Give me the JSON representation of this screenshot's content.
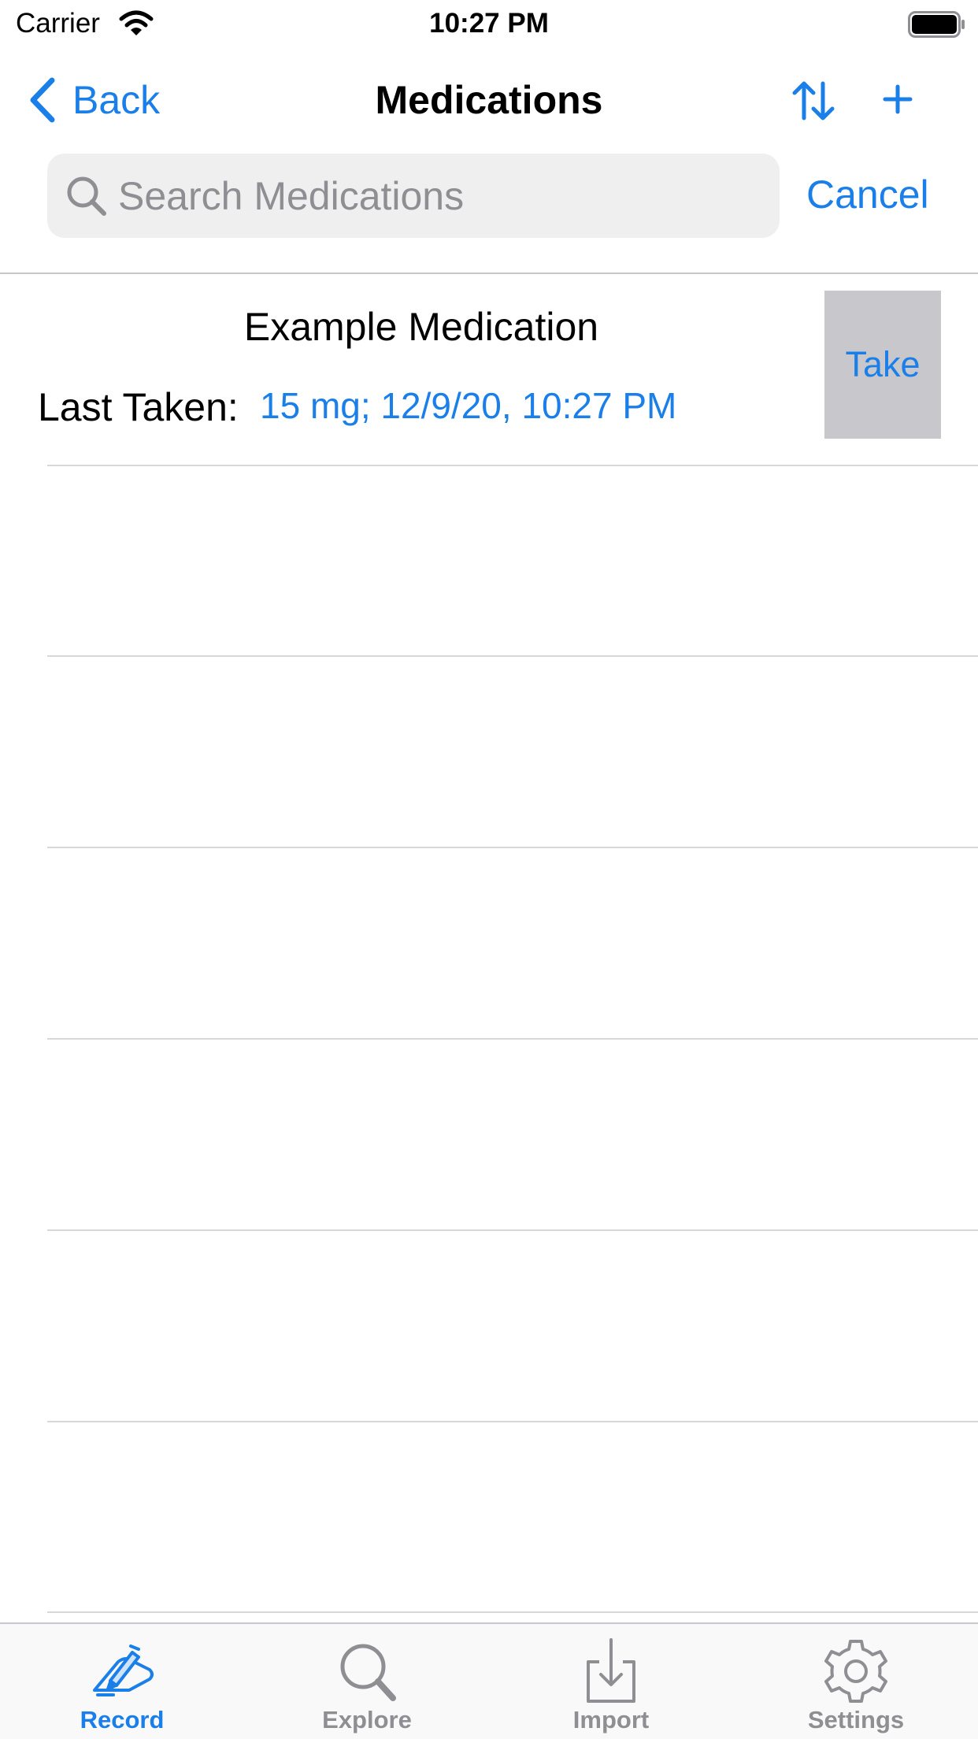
{
  "status_bar": {
    "carrier": "Carrier",
    "time": "10:27 PM"
  },
  "nav": {
    "back_label": "Back",
    "title": "Medications",
    "sort_icon": "sort-arrows-icon",
    "add_label": "+"
  },
  "search": {
    "placeholder": "Search Medications",
    "value": "",
    "cancel_label": "Cancel"
  },
  "medications": [
    {
      "name": "Example Medication",
      "last_taken_label": "Last Taken:",
      "last_taken_value": "15 mg; 12/9/20, 10:27 PM",
      "action_label": "Take"
    }
  ],
  "tabs": [
    {
      "label": "Record",
      "icon": "pencil-hand-icon",
      "active": true
    },
    {
      "label": "Explore",
      "icon": "magnifier-icon",
      "active": false
    },
    {
      "label": "Import",
      "icon": "import-tray-icon",
      "active": false
    },
    {
      "label": "Settings",
      "icon": "gear-icon",
      "active": false
    }
  ],
  "colors": {
    "accent": "#1a7fe8",
    "inactive": "#8e8e93",
    "take_button_bg": "#c7c7cc",
    "search_bg": "#efeff0"
  }
}
